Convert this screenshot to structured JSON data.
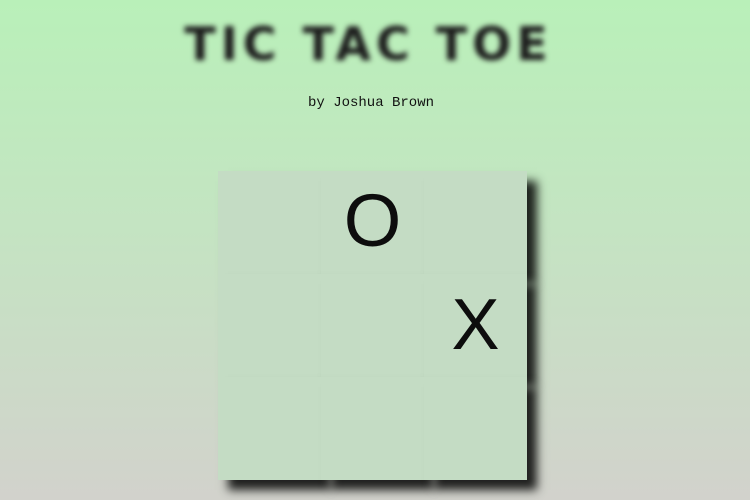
{
  "header": {
    "title": "TIC TAC TOE",
    "byline": "by Joshua Brown"
  },
  "board": {
    "cells": [
      "",
      "O",
      "",
      "",
      "",
      "X",
      "",
      "",
      ""
    ]
  },
  "colors": {
    "background_top": "#b9f0b9",
    "background_bottom": "#d2d2cc",
    "cell": "#c4dcc4",
    "mark": "#0d0d0d"
  }
}
